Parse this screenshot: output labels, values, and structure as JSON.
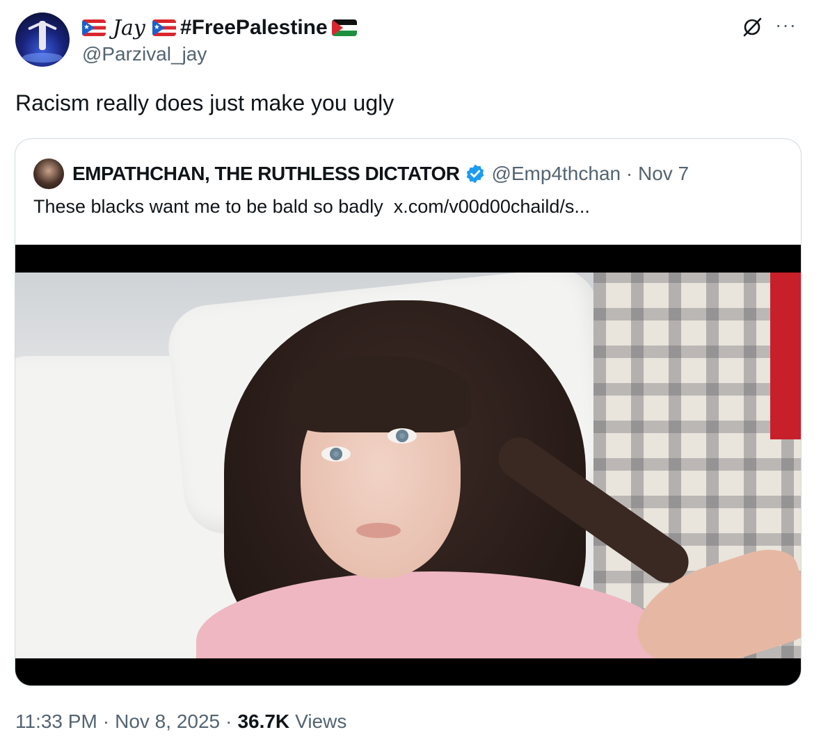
{
  "author": {
    "display_name_script": "Jay",
    "display_name_hashtag": "#FreePalestine",
    "handle": "@Parzival_jay"
  },
  "icons": {
    "flag_left": "puerto-rico-flag-icon",
    "flag_right": "palestine-flag-icon",
    "grok": "grok-icon",
    "more": "more-icon",
    "verified": "verified-badge-icon"
  },
  "tweet": {
    "text": "Racism really does just make you ugly",
    "more_glyph": "···"
  },
  "quoted": {
    "name": "EMPATHCHAN, THE RUTHLESS DICTATOR",
    "handle_date": "@Emp4thchan · Nov 7",
    "text": "These blacks want me to be bald so badly  x.com/v00d00chaild/s..."
  },
  "meta": {
    "time": "11:33 PM",
    "sep1": "·",
    "date": "Nov 8, 2025",
    "sep2": "·",
    "views_count": "36.7K",
    "views_label": "Views"
  },
  "colors": {
    "text_primary": "#0f1419",
    "text_secondary": "#536471",
    "border": "#cfd9de",
    "verified_blue": "#1d9bf0"
  }
}
